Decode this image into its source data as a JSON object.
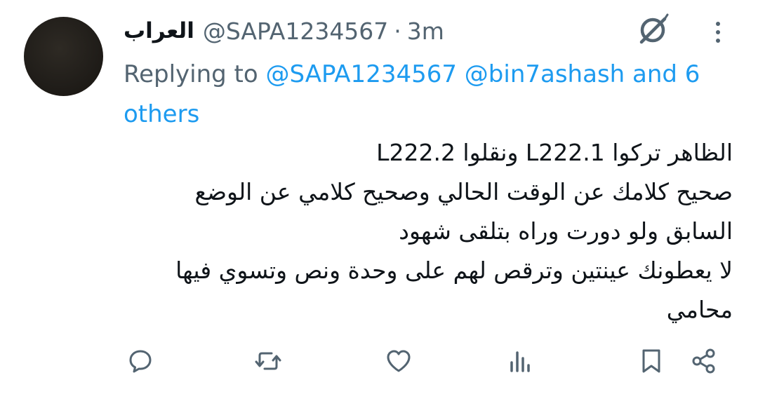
{
  "tweet": {
    "author_name": "العراب",
    "author_handle": "@SAPA1234567",
    "separator": "·",
    "time": "3m",
    "replying_prefix": "Replying to",
    "reply_mentions": [
      "@SAPA1234567",
      "@bin7ashash"
    ],
    "reply_others": "and 6 others",
    "text": "الظاهر تركوا L222.1 ونقلوا L222.2\nصحيح كلامك عن الوقت الحالي وصحيح كلامي عن الوضع السابق ولو دورت وراه بتلقى شهود\nلا يعطونك عينتين وترقص لهم على وحدة ونص وتسوي فيها محامي"
  },
  "icons": {
    "header": [
      "grok-icon",
      "more-vertical-icon"
    ],
    "actions": [
      "reply-icon",
      "retweet-icon",
      "like-icon",
      "views-icon",
      "bookmark-icon",
      "share-icon"
    ]
  },
  "colors": {
    "text_primary": "#0f1419",
    "text_secondary": "#536471",
    "link": "#1d9bf0",
    "background": "#ffffff"
  }
}
